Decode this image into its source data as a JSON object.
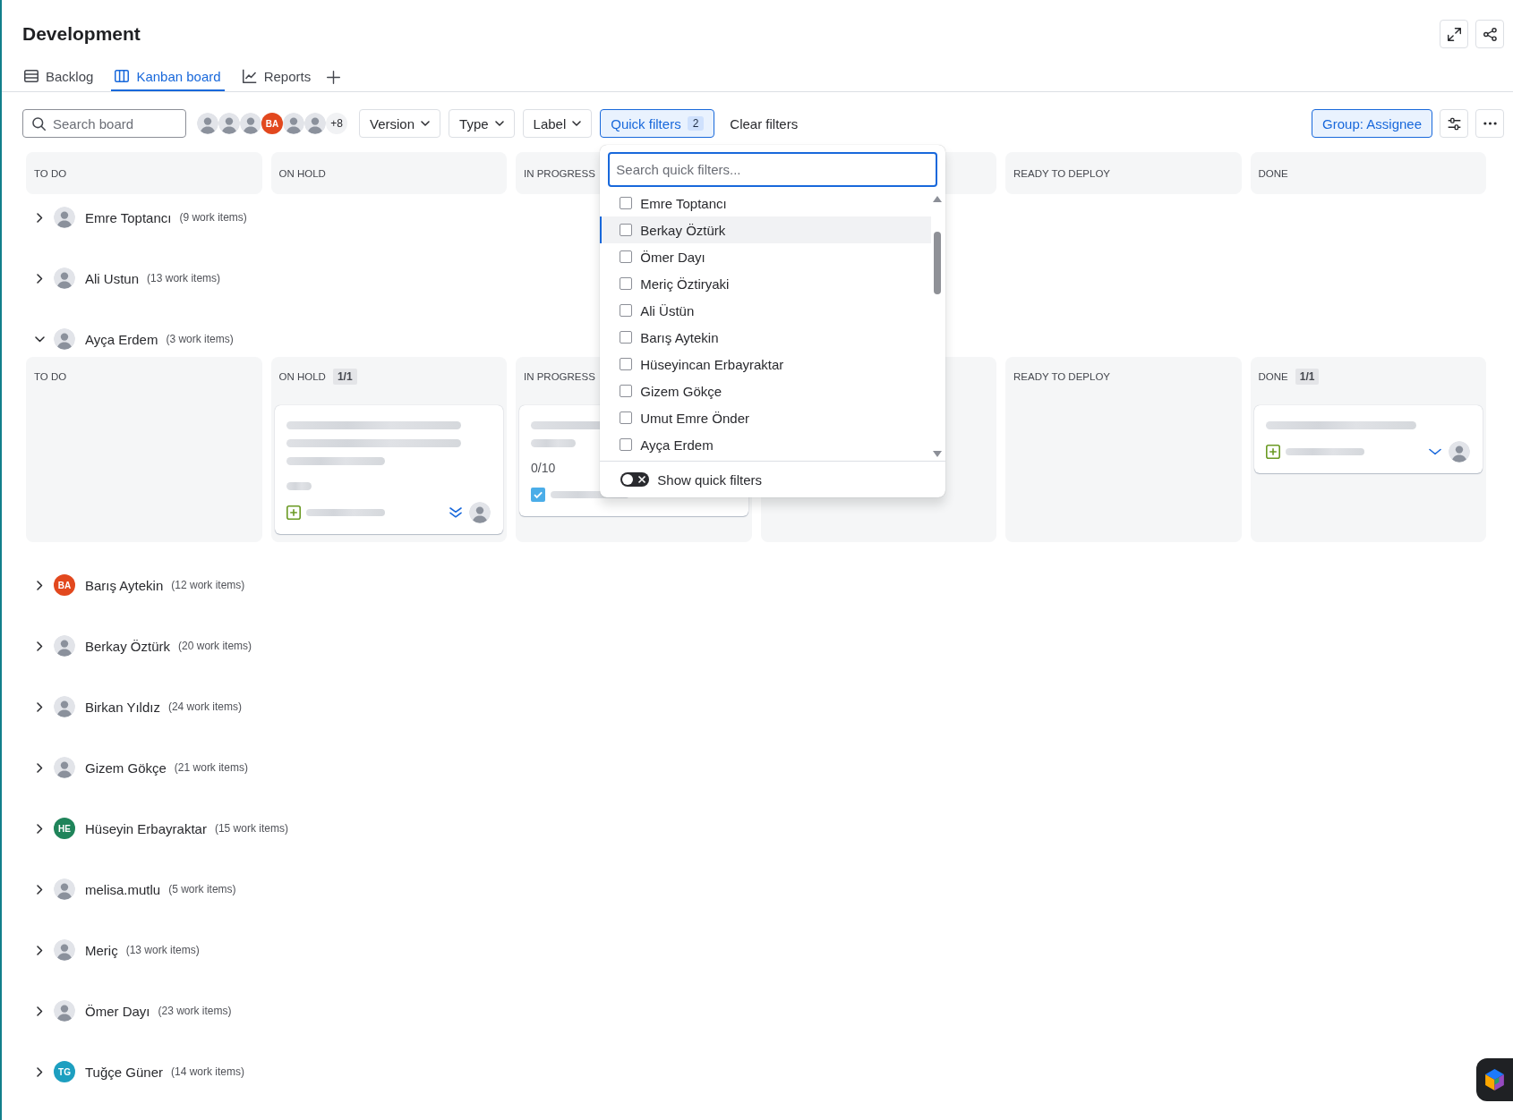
{
  "page": {
    "title": "Development"
  },
  "tabs": [
    {
      "label": "Backlog",
      "kind": "backlog",
      "selected": false
    },
    {
      "label": "Kanban board",
      "kind": "board",
      "selected": true
    },
    {
      "label": "Reports",
      "kind": "reports",
      "selected": false
    }
  ],
  "toolbar": {
    "search": {
      "placeholder": "Search board"
    },
    "avatars": [
      {
        "kind": "photo"
      },
      {
        "kind": "photo"
      },
      {
        "kind": "photo"
      },
      {
        "kind": "initials",
        "initials": "BA",
        "color": "#e2481e"
      },
      {
        "kind": "photo"
      },
      {
        "kind": "photo"
      }
    ],
    "more_avatars": "+8",
    "filters": [
      {
        "label": "Version",
        "kind": "dropdown",
        "selected": false
      },
      {
        "label": "Type",
        "kind": "dropdown",
        "selected": false
      },
      {
        "label": "Label",
        "kind": "dropdown",
        "selected": false
      },
      {
        "label": "Quick filters",
        "kind": "menu",
        "count": "2",
        "selected": true,
        "menu": {
          "search": {
            "placeholder": "Search quick filters..."
          },
          "items": [
            {
              "label": "Emre Toptancı",
              "checked": false,
              "selected": false
            },
            {
              "label": "Berkay Öztürk",
              "checked": false,
              "selected": true
            },
            {
              "label": "Ömer Dayı",
              "checked": false,
              "selected": false
            },
            {
              "label": "Meriç Öztiryaki",
              "checked": false,
              "selected": false
            },
            {
              "label": "Ali Üstün",
              "checked": false,
              "selected": false
            },
            {
              "label": "Barış Aytekin",
              "checked": false,
              "selected": false
            },
            {
              "label": "Hüseyincan Erbayraktar",
              "checked": false,
              "selected": false
            },
            {
              "label": "Gizem Gökçe",
              "checked": false,
              "selected": false
            },
            {
              "label": "Umut Emre Önder",
              "checked": false,
              "selected": false
            },
            {
              "label": "Ayça Erdem",
              "checked": false,
              "selected": false
            }
          ],
          "toggle": {
            "label": "Show quick filters",
            "on": false
          }
        }
      }
    ],
    "clear_filters": "Clear filters",
    "group_by": {
      "label": "Group: Assignee",
      "active": true
    }
  },
  "board": {
    "columns": [
      {
        "label": "TO DO"
      },
      {
        "label": "ON HOLD"
      },
      {
        "label": "IN PROGRESS"
      },
      {},
      {
        "label": "READY TO DEPLOY"
      },
      {
        "label": "DONE"
      }
    ],
    "lanes": [
      {
        "name": "Emre Toptancı",
        "count": "(9 work items)",
        "avatar": {
          "kind": "photo"
        },
        "expanded": false
      },
      {
        "name": "Ali Ustun",
        "count": "(13 work items)",
        "avatar": {
          "kind": "photo"
        },
        "expanded": false
      },
      {
        "name": "Ayça Erdem",
        "count": "(3 work items)",
        "avatar": {
          "kind": "photo"
        },
        "expanded": true,
        "cells": [
          {
            "label": "TO DO"
          },
          {
            "label": "ON HOLD",
            "badge": "1/1",
            "cards": [
              {
                "kind": "feature",
                "title_lines": [
                  {
                    "kind": "full"
                  },
                  {
                    "kind": "full"
                  },
                  {
                    "kind": "medium"
                  }
                ],
                "progress": {
                  "kind": "blurred"
                },
                "priority": {
                  "kind": "lowest"
                },
                "assignee": {
                  "kind": "photo"
                }
              }
            ]
          },
          {
            "label": "IN PROGRESS",
            "cards": [
              {
                "kind": "task",
                "title_lines": [
                  {
                    "kind": "full"
                  },
                  {
                    "kind": "short"
                  }
                ],
                "progress": {
                  "kind": "text",
                  "text": "0/10"
                }
              }
            ]
          },
          {},
          {
            "label": "READY TO DEPLOY"
          },
          {
            "label": "DONE",
            "badge": "1/1",
            "cards": [
              {
                "kind": "feature",
                "title_lines": [
                  {
                    "kind": "long"
                  }
                ],
                "priority": {
                  "kind": "low"
                },
                "assignee": {
                  "kind": "photo"
                }
              }
            ]
          }
        ]
      },
      {
        "name": "Barış Aytekin",
        "count": "(12 work items)",
        "avatar": {
          "kind": "initials",
          "initials": "BA",
          "color": "#e2481e"
        },
        "expanded": false
      },
      {
        "name": "Berkay Öztürk",
        "count": "(20 work items)",
        "avatar": {
          "kind": "photo"
        },
        "expanded": false
      },
      {
        "name": "Birkan Yıldız",
        "count": "(24 work items)",
        "avatar": {
          "kind": "photo"
        },
        "expanded": false
      },
      {
        "name": "Gizem Gökçe",
        "count": "(21 work items)",
        "avatar": {
          "kind": "photo"
        },
        "expanded": false
      },
      {
        "name": "Hüseyin Erbayraktar",
        "count": "(15 work items)",
        "avatar": {
          "kind": "initials",
          "initials": "HE",
          "color": "#1f845a"
        },
        "expanded": false
      },
      {
        "name": "melisa.mutlu",
        "count": "(5 work items)",
        "avatar": {
          "kind": "photo"
        },
        "expanded": false
      },
      {
        "name": "Meriç",
        "count": "(13 work items)",
        "avatar": {
          "kind": "photo"
        },
        "expanded": false
      },
      {
        "name": "Ömer Dayı",
        "count": "(23 work items)",
        "avatar": {
          "kind": "photo"
        },
        "expanded": false
      },
      {
        "name": "Tuğçe Güner",
        "count": "(14 work items)",
        "avatar": {
          "kind": "initials",
          "initials": "TG",
          "color": "#1d9fc0"
        },
        "expanded": false
      }
    ]
  }
}
